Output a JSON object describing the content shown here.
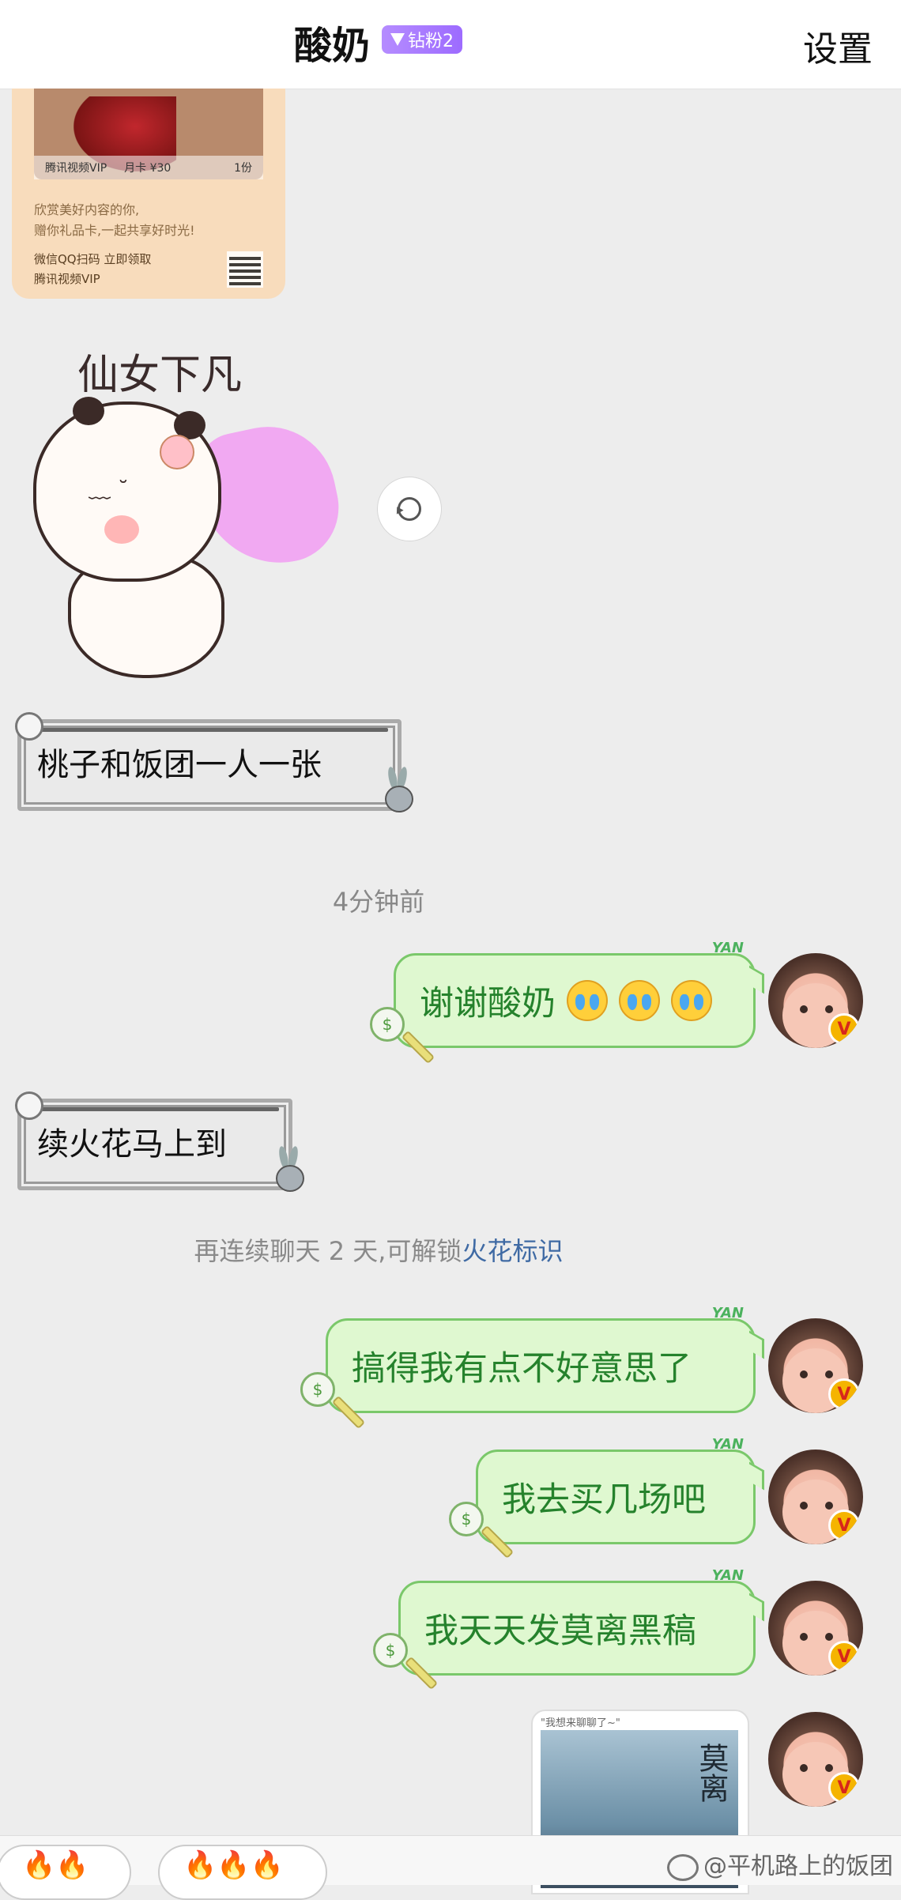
{
  "header": {
    "title": "酸奶",
    "badge": "钻粉2",
    "settings": "设置"
  },
  "ticket": {
    "vip_label": "腾讯视频VIP",
    "price": "月卡 ¥30",
    "count": "1份",
    "line1": "欣赏美好内容的你,",
    "line2": "赠你礼品卡,一起共享好时光!",
    "scan_text": "微信QQ扫码 立即领取",
    "brand": "腾讯视频VIP"
  },
  "sticker": {
    "caption": "仙女下凡"
  },
  "messages": {
    "in1": "桃子和饭团一人一张",
    "timestamp": "4分钟前",
    "out1": "谢谢酸奶",
    "in2": "续火花马上到",
    "system_prefix": "再连续聊天 2 天,可解锁",
    "system_link": "火花标识",
    "out2": "搞得我有点不好意思了",
    "out3": "我去买几场吧",
    "out4": "我天天发莫离黑稿",
    "bubble_tag": "YAN"
  },
  "poster": {
    "caption": "\"我想来聊聊了~\"",
    "title": "莫离"
  },
  "bottom": {
    "pill1": "🔥🔥",
    "pill2": "🔥🔥🔥",
    "watermark": "@平机路上的饭团"
  },
  "colors": {
    "out_bubble_bg": "#dff8d0",
    "out_text": "#25822c",
    "badge": "#a57bff",
    "link": "#3f6aa4"
  }
}
